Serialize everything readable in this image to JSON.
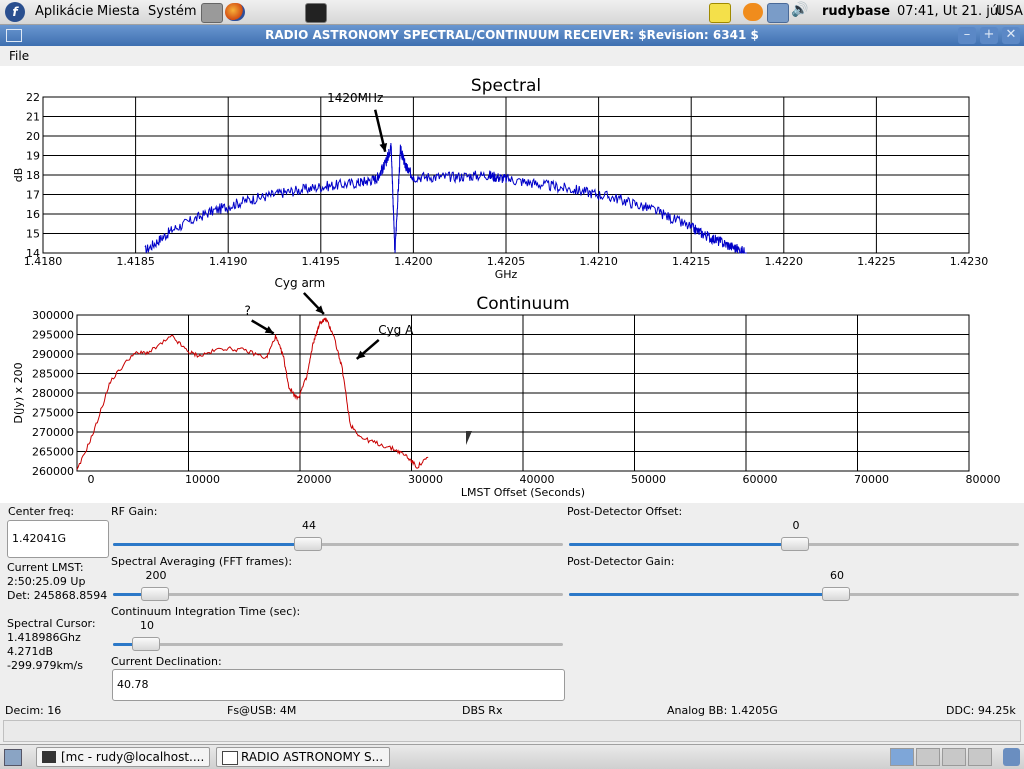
{
  "top_panel": {
    "menus": [
      "Aplikácie",
      "Miesta",
      "Systém"
    ],
    "user": "rudybase",
    "clock": "07:41, Ut 21. júl",
    "locale": "USA"
  },
  "window": {
    "title": "RADIO ASTRONOMY SPECTRAL/CONTINUUM RECEIVER: $Revision: 6341 $",
    "menu_file": "File"
  },
  "chart_data": [
    {
      "type": "line",
      "title": "Spectral",
      "xlabel": "GHz",
      "ylabel": "dB",
      "xlim": [
        1.418,
        1.423
      ],
      "ylim": [
        14,
        22
      ],
      "x_ticks": [
        "1.4180",
        "1.4185",
        "1.4190",
        "1.4195",
        "1.4200",
        "1.4205",
        "1.4210",
        "1.4215",
        "1.4220",
        "1.4225",
        "1.4230"
      ],
      "y_ticks": [
        "22",
        "21",
        "20",
        "19",
        "18",
        "17",
        "16",
        "15",
        "14"
      ],
      "grid": true,
      "color": "#0000c8",
      "series": [
        {
          "x": [
            1.41855,
            1.4187,
            1.4189,
            1.4191,
            1.4193,
            1.4195,
            1.4197,
            1.4198,
            1.41985,
            1.41988,
            1.4199,
            1.41993,
            1.41996,
            1.42,
            1.4202,
            1.4204,
            1.4205,
            1.4207,
            1.4209,
            1.4211,
            1.4213,
            1.4215,
            1.4216,
            1.4217,
            1.4218
          ],
          "y": [
            14.1,
            15.2,
            16.1,
            16.7,
            17.1,
            17.4,
            17.6,
            17.8,
            18.6,
            19.5,
            14.0,
            19.3,
            18.4,
            17.9,
            17.9,
            18.0,
            17.8,
            17.5,
            17.2,
            16.8,
            16.2,
            15.3,
            14.8,
            14.4,
            14.0
          ]
        }
      ],
      "annotations": [
        {
          "text": "1420MHz",
          "x": 1.41988,
          "y": 19.5
        }
      ]
    },
    {
      "type": "line",
      "title": "Continuum",
      "xlabel": "LMST Offset (Seconds)",
      "ylabel": "D(Jy) x 200",
      "xlim": [
        0,
        80000
      ],
      "ylim": [
        260000,
        300000
      ],
      "x_ticks": [
        "0",
        "10000",
        "20000",
        "30000",
        "40000",
        "50000",
        "60000",
        "70000",
        "80000"
      ],
      "y_ticks": [
        "300000",
        "295000",
        "290000",
        "285000",
        "280000",
        "275000",
        "270000",
        "265000",
        "260000"
      ],
      "grid": true,
      "color": "#c80000",
      "series": [
        {
          "x": [
            0,
            1500,
            3000,
            5000,
            6500,
            8500,
            10000,
            11000,
            13000,
            15000,
            17000,
            17800,
            18500,
            19000,
            19800,
            20600,
            21200,
            21800,
            22300,
            23000,
            23800,
            24500,
            25500,
            27000,
            28500,
            29500,
            30500,
            31500
          ],
          "y": [
            260000,
            270000,
            283000,
            290000,
            290500,
            294500,
            290500,
            289500,
            291500,
            291000,
            289000,
            294500,
            289500,
            281500,
            278500,
            284000,
            293000,
            298000,
            299000,
            295000,
            286000,
            272000,
            268500,
            267000,
            265500,
            264000,
            261000,
            263500
          ]
        }
      ],
      "annotations": [
        {
          "text": "?",
          "x": 18000,
          "y": 295000
        },
        {
          "text": "Cyg arm",
          "x": 22500,
          "y": 299500
        },
        {
          "text": "Cyg A",
          "x": 25000,
          "y": 289000
        }
      ]
    }
  ],
  "controls": {
    "center_freq_label": "Center freq:",
    "center_freq_value": "1.42041G",
    "lmst_label": "Current LMST:",
    "lmst_value": "2:50:25.09 Up",
    "det_value": "Det: 245868.8594",
    "cursor_label": "Spectral Cursor:",
    "cursor_freq": "1.418986Ghz",
    "cursor_db": "4.271dB",
    "cursor_vel": "-299.979km/s",
    "rf_gain_label": "RF Gain:",
    "rf_gain_value": "44",
    "rf_gain_fraction": 0.43,
    "avg_label": "Spectral Averaging (FFT frames):",
    "avg_value": "200",
    "avg_fraction": 0.09,
    "integ_label": "Continuum Integration Time (sec):",
    "integ_value": "10",
    "integ_fraction": 0.07,
    "decl_label": "Current Declination:",
    "decl_value": "40.78",
    "pd_offset_label": "Post-Detector Offset:",
    "pd_offset_value": "0",
    "pd_offset_fraction": 0.5,
    "pd_gain_label": "Post-Detector Gain:",
    "pd_gain_value": "60",
    "pd_gain_fraction": 0.59
  },
  "status": {
    "decim": "Decim: 16",
    "fs": "Fs@USB: 4M",
    "dbs": "DBS Rx",
    "analog": "Analog BB: 1.4205G",
    "ddc": "DDC: 94.25k"
  },
  "taskbar": {
    "task1": "[mc - rudy@localhost....",
    "task2": "RADIO ASTRONOMY S..."
  }
}
